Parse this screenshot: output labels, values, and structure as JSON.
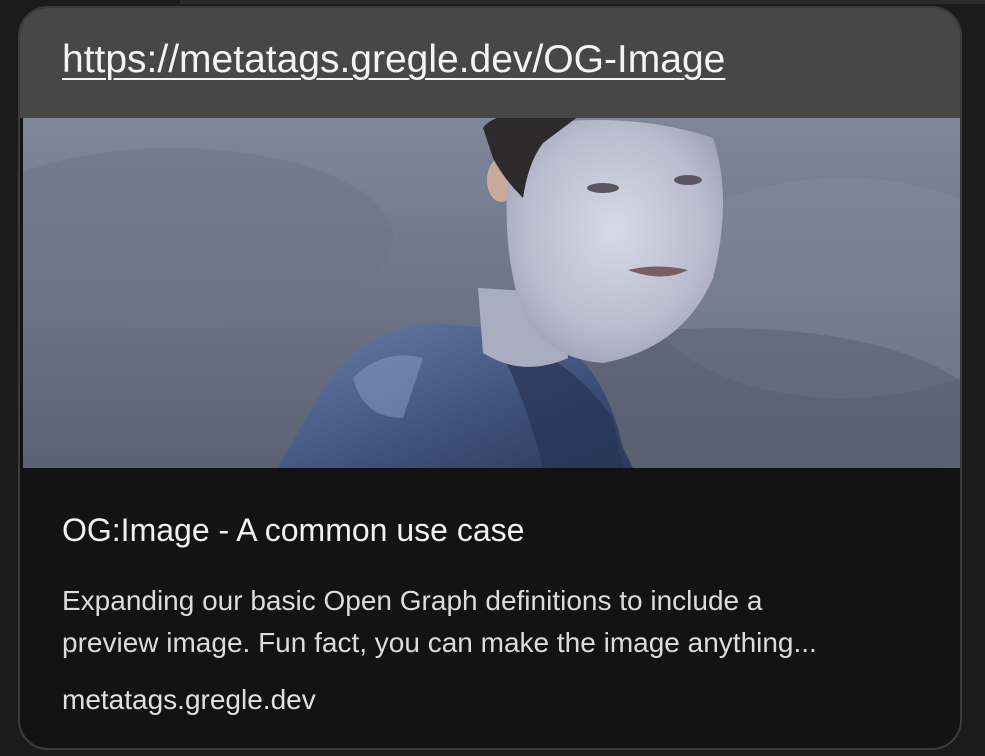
{
  "link_preview": {
    "url": "https://metatags.gregle.dev/OG-Image",
    "image_icon": "person-photo-icon",
    "title": "OG:Image - A common use case",
    "description_lines": [
      "Expanding our basic Open Graph definitions to include a",
      "preview image. Fun fact, you can make the image anything..."
    ],
    "domain": "metatags.gregle.dev"
  },
  "colors": {
    "card_background": "#131313",
    "url_bar_background": "#474747",
    "text_primary": "#f1f1f1"
  }
}
